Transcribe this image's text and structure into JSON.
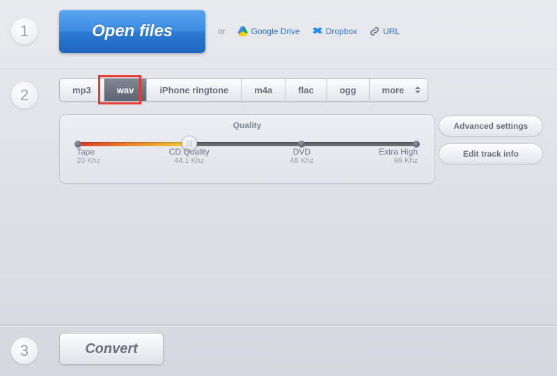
{
  "step1": {
    "num": "1",
    "open_label": "Open files",
    "or": "or",
    "sources": {
      "gdrive": "Google Drive",
      "dropbox": "Dropbox",
      "url": "URL"
    }
  },
  "step2": {
    "num": "2",
    "formats": [
      "mp3",
      "wav",
      "iPhone ringtone",
      "m4a",
      "flac",
      "ogg",
      "more"
    ],
    "selected_index": 1,
    "quality": {
      "title": "Quality",
      "ticks": [
        {
          "label": "Tape",
          "sub": "20 Khz"
        },
        {
          "label": "CD Quality",
          "sub": "44.1 Khz"
        },
        {
          "label": "DVD",
          "sub": "48 Khz"
        },
        {
          "label": "Extra High",
          "sub": "96 Khz"
        }
      ],
      "value_index": 1
    },
    "advanced": "Advanced settings",
    "edit_track": "Edit track info"
  },
  "step3": {
    "num": "3",
    "convert": "Convert"
  }
}
